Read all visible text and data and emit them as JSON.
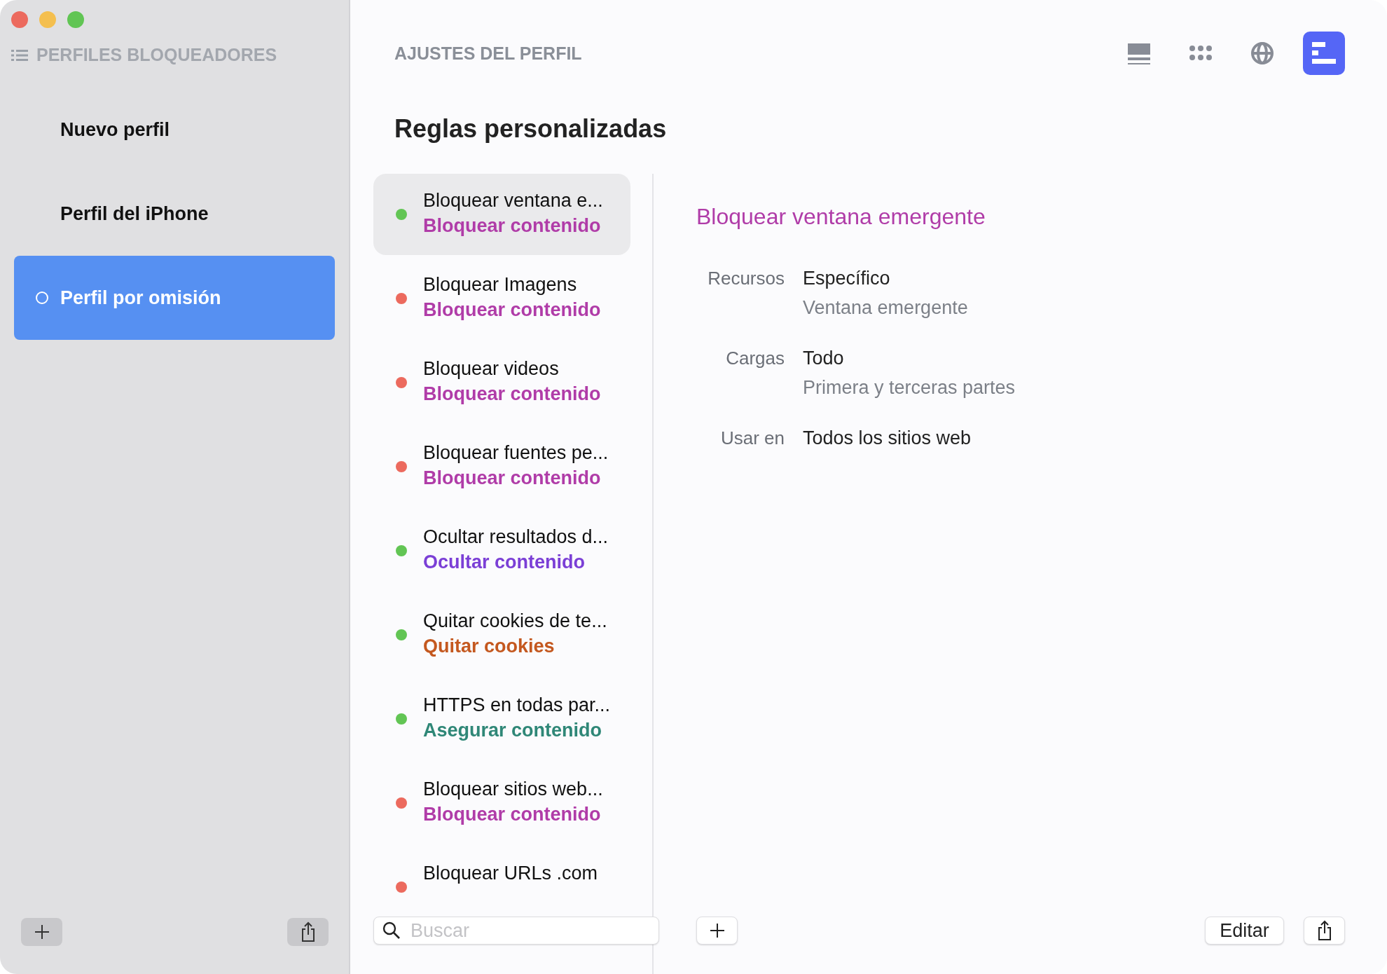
{
  "sidebar": {
    "title": "PERFILES BLOQUEADORES",
    "items": [
      {
        "label": "Nuevo perfil",
        "selected": false
      },
      {
        "label": "Perfil del iPhone",
        "selected": false
      },
      {
        "label": "Perfil por omisión",
        "selected": true
      }
    ]
  },
  "header": {
    "title": "AJUSTES DEL PERFIL"
  },
  "toolbar": [
    {
      "kind": "list",
      "selected": false
    },
    {
      "kind": "apps",
      "selected": false
    },
    {
      "kind": "globe",
      "selected": false
    },
    {
      "kind": "timeline",
      "selected": true
    }
  ],
  "section_title": "Reglas personalizadas",
  "rules": [
    {
      "title": "Bloquear ventana e...",
      "action": "Bloquear contenido",
      "color": "#b03ca8",
      "enabled": true,
      "selected": true
    },
    {
      "title": "Bloquear Imagens",
      "action": "Bloquear contenido",
      "color": "#b03ca8",
      "enabled": false,
      "selected": false
    },
    {
      "title": "Bloquear videos",
      "action": "Bloquear contenido",
      "color": "#b03ca8",
      "enabled": false,
      "selected": false
    },
    {
      "title": "Bloquear fuentes pe...",
      "action": "Bloquear contenido",
      "color": "#b03ca8",
      "enabled": false,
      "selected": false
    },
    {
      "title": "Ocultar resultados d...",
      "action": "Ocultar contenido",
      "color": "#7b3fd6",
      "enabled": true,
      "selected": false
    },
    {
      "title": "Quitar cookies de te...",
      "action": "Quitar cookies",
      "color": "#c4581f",
      "enabled": true,
      "selected": false
    },
    {
      "title": "HTTPS en todas par...",
      "action": "Asegurar contenido",
      "color": "#2f8777",
      "enabled": true,
      "selected": false
    },
    {
      "title": "Bloquear sitios web...",
      "action": "Bloquear contenido",
      "color": "#b03ca8",
      "enabled": false,
      "selected": false
    },
    {
      "title": "Bloquear URLs .com",
      "enabled": false,
      "selected": false
    }
  ],
  "search": {
    "placeholder": "Buscar"
  },
  "detail": {
    "title": "Bloquear ventana emergente",
    "rows": [
      {
        "label": "Recursos",
        "value": "Específico",
        "secondary": "Ventana emergente"
      },
      {
        "label": "Cargas",
        "value": "Todo",
        "secondary": "Primera y terceras partes"
      },
      {
        "label": "Usar en",
        "value": "Todos los sitios web"
      }
    ]
  },
  "edit_button": "Editar"
}
